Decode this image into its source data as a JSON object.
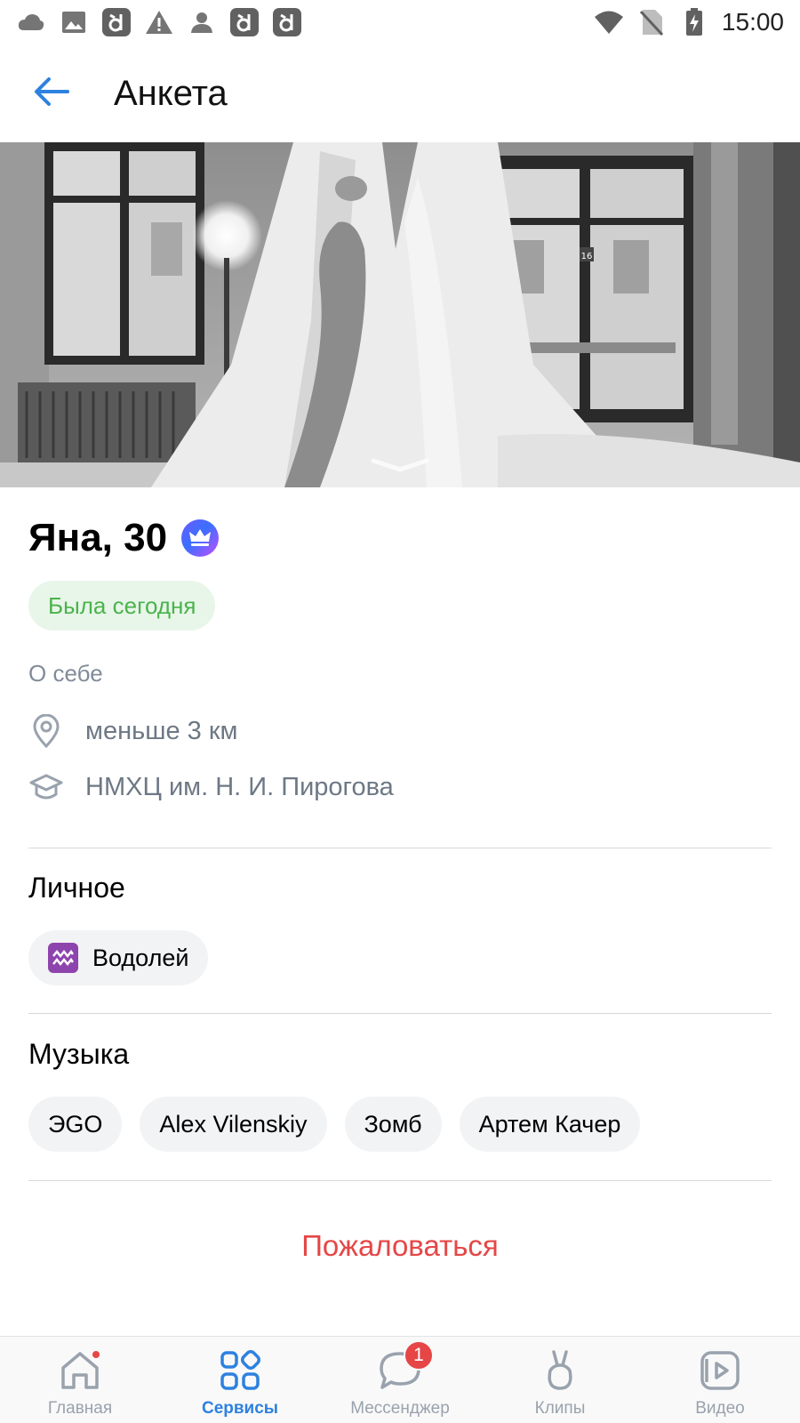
{
  "status_bar": {
    "time": "15:00",
    "left_icons": [
      "cloud-icon",
      "image-icon",
      "app-d-icon",
      "warning-icon",
      "person-icon",
      "app-d-icon",
      "app-d-icon"
    ],
    "right_icons": [
      "wifi-icon",
      "no-sim-icon",
      "battery-charging-icon"
    ]
  },
  "app_bar": {
    "title": "Анкета",
    "back_icon": "arrow-left-icon"
  },
  "profile": {
    "name_age": "Яна, 30",
    "premium_icon": "crown-icon",
    "last_seen": "Была сегодня",
    "about_label": "О себе",
    "distance": "меньше 3 км",
    "education": "НМХЦ им. Н. И. Пирогова"
  },
  "personal": {
    "title": "Личное",
    "zodiac": "Водолей"
  },
  "music": {
    "title": "Музыка",
    "artists": [
      "ЭGO",
      "Alex Vilenskiy",
      "Зомб",
      "Артем Качер"
    ]
  },
  "report_label": "Пожаловаться",
  "tabbar": {
    "tabs": [
      {
        "label": "Главная",
        "icon": "home-icon",
        "active": false,
        "dot": true
      },
      {
        "label": "Сервисы",
        "icon": "services-icon",
        "active": true
      },
      {
        "label": "Мессенджер",
        "icon": "messenger-icon",
        "active": false,
        "badge": "1"
      },
      {
        "label": "Клипы",
        "icon": "clips-icon",
        "active": false
      },
      {
        "label": "Видео",
        "icon": "video-icon",
        "active": false
      }
    ]
  },
  "colors": {
    "accent": "#2d81e0",
    "online_green": "#4bb34b",
    "danger_red": "#e64646",
    "secondary_text": "#818c99"
  }
}
